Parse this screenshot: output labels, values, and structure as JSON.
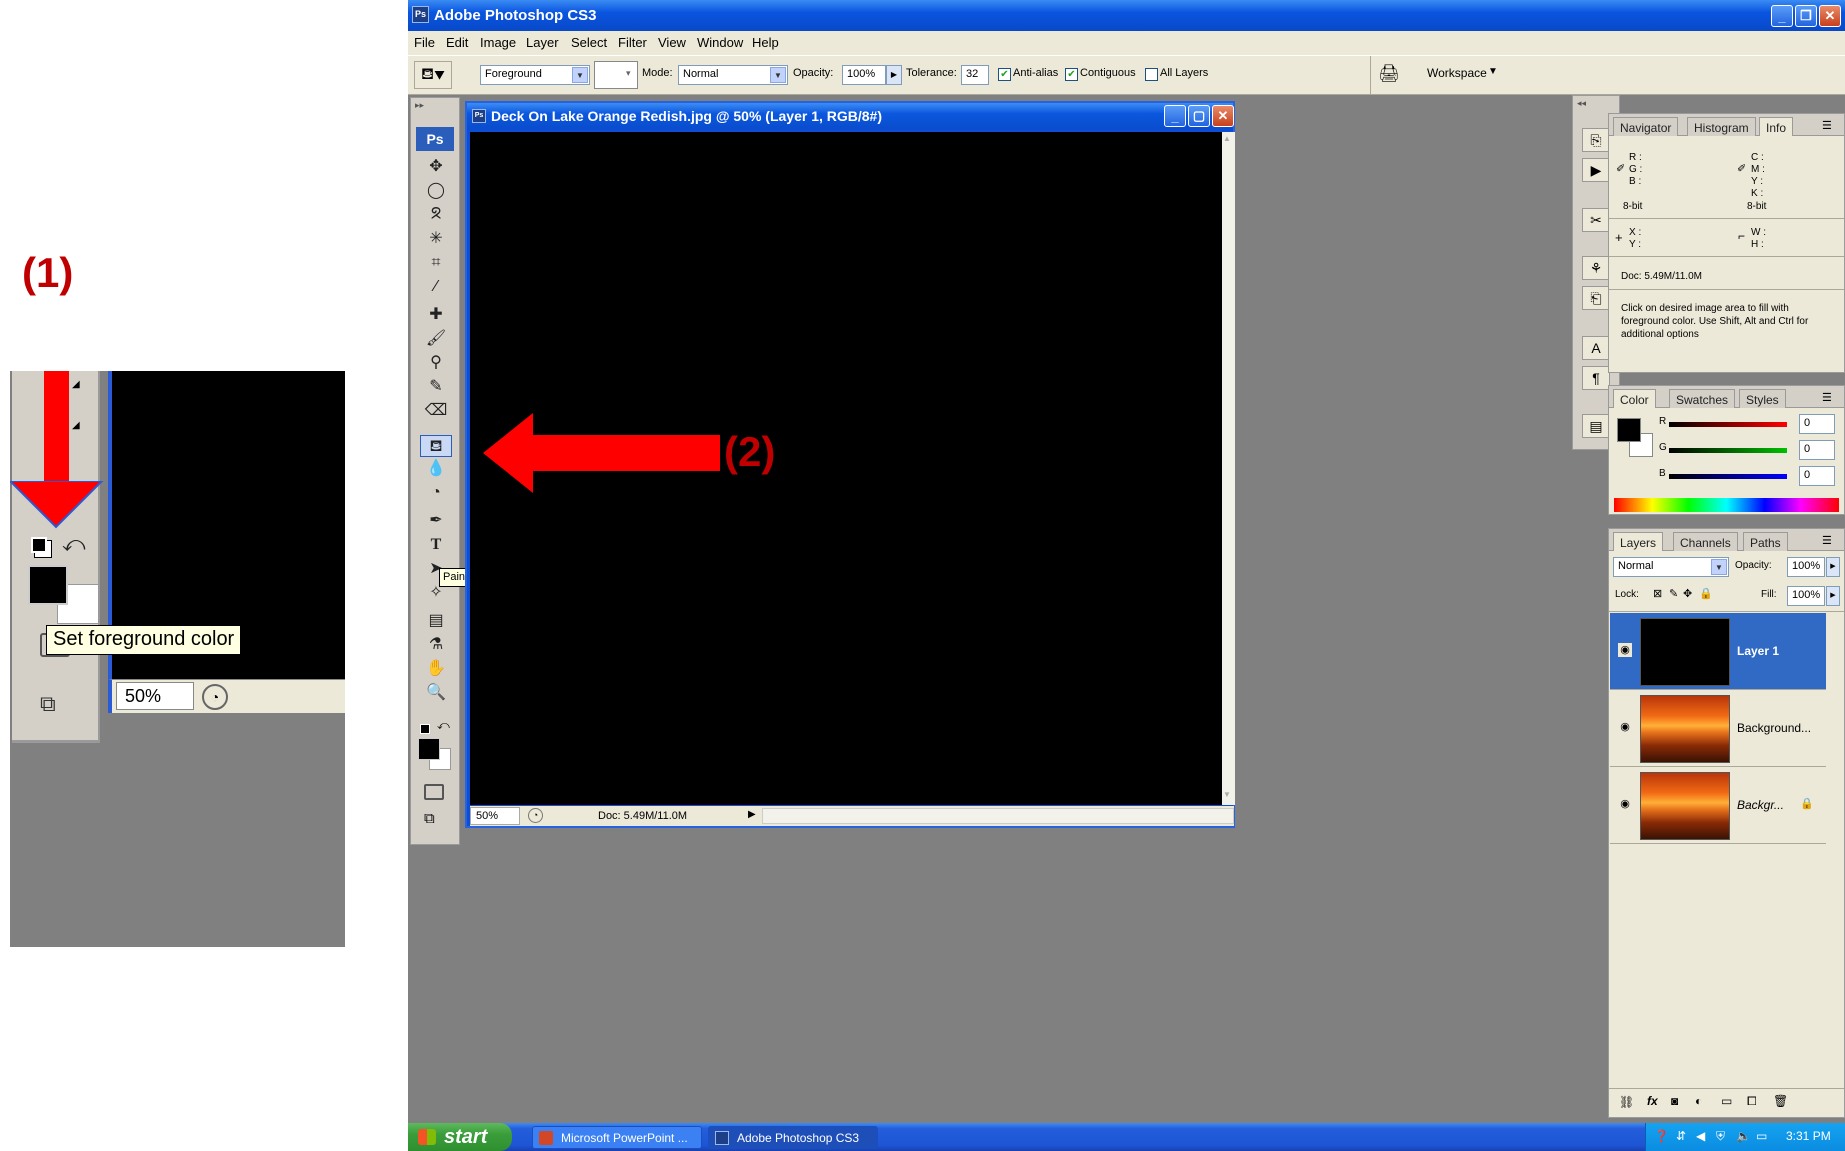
{
  "annotations": {
    "marker_1": "(1)",
    "marker_2": "(2)"
  },
  "inset": {
    "tooltip": "Set foreground color",
    "zoom": "50%"
  },
  "app": {
    "title": "Adobe Photoshop CS3",
    "menu": [
      "File",
      "Edit",
      "Image",
      "Layer",
      "Select",
      "Filter",
      "View",
      "Window",
      "Help"
    ]
  },
  "options": {
    "fill_source": "Foreground",
    "mode_label": "Mode:",
    "mode_value": "Normal",
    "opacity_label": "Opacity:",
    "opacity_value": "100%",
    "tolerance_label": "Tolerance:",
    "tolerance_value": "32",
    "anti_alias": "Anti-alias",
    "contiguous": "Contiguous",
    "all_layers": "All Layers",
    "workspace": "Workspace"
  },
  "toolbox": {
    "logo": "Ps",
    "tooltip": "Paint Bucket Tool (G)"
  },
  "document": {
    "title": "Deck On Lake Orange Redish.jpg @ 50% (Layer 1, RGB/8#)",
    "zoom": "50%",
    "doc_size": "Doc: 5.49M/11.0M"
  },
  "info_panel": {
    "tabs": [
      "Navigator",
      "Histogram",
      "Info"
    ],
    "r": "R :",
    "g": "G :",
    "b": "B :",
    "c": "C :",
    "m": "M :",
    "y": "Y :",
    "k": "K :",
    "bit_left": "8-bit",
    "bit_right": "8-bit",
    "x": "X :",
    "yy": "Y :",
    "w": "W :",
    "h": "H :",
    "doc": "Doc: 5.49M/11.0M",
    "hint": "Click on desired image area to fill with foreground color.  Use Shift, Alt and Ctrl for additional options"
  },
  "color_panel": {
    "tabs": [
      "Color",
      "Swatches",
      "Styles"
    ],
    "r_label": "R",
    "g_label": "G",
    "b_label": "B",
    "r_value": "0",
    "g_value": "0",
    "b_value": "0"
  },
  "layers_panel": {
    "tabs": [
      "Layers",
      "Channels",
      "Paths"
    ],
    "blend": "Normal",
    "opacity_label": "Opacity:",
    "opacity_value": "100%",
    "lock_label": "Lock:",
    "fill_label": "Fill:",
    "fill_value": "100%",
    "layers": [
      {
        "name": "Layer 1"
      },
      {
        "name": "Background..."
      },
      {
        "name": "Backgr..."
      }
    ]
  },
  "taskbar": {
    "start": "start",
    "tasks": [
      "Microsoft PowerPoint ...",
      "Adobe Photoshop CS3"
    ],
    "time": "3:31 PM"
  },
  "colors": {
    "accent_red": "#ff0000",
    "xp_blue": "#0a55e0",
    "selected_layer": "#316ac5"
  }
}
